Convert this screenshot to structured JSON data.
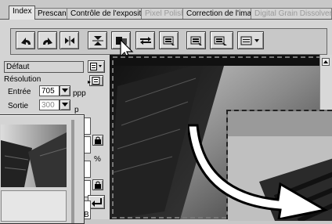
{
  "tabs": [
    {
      "label": "Index",
      "state": "active"
    },
    {
      "label": "Prescan",
      "state": "normal"
    },
    {
      "label": "Contrôle de l'exposition",
      "state": "normal"
    },
    {
      "label": "Pixel Polish",
      "state": "disabled"
    },
    {
      "label": "Correction de l'image",
      "state": "normal"
    },
    {
      "label": "Digital Grain Dissolver",
      "state": "disabled"
    }
  ],
  "toolbar": {
    "buttons": [
      {
        "name": "rotate-left-icon"
      },
      {
        "name": "rotate-right-icon"
      },
      {
        "name": "flip-horizontal-icon"
      },
      {
        "name": "flip-vertical-icon"
      },
      {
        "name": "compare-view-icon"
      },
      {
        "name": "swap-icon"
      },
      {
        "name": "scan-batch-icon"
      },
      {
        "name": "scan-batch-2-icon"
      },
      {
        "name": "options-menu-icon"
      }
    ]
  },
  "settings": {
    "preset_value": "Défaut",
    "resolution_label": "Résolution",
    "input_label": "Entrée",
    "input_value": "705",
    "input_unit": "ppp",
    "output_label": "Sortie",
    "output_value": "300",
    "output_unit": "p",
    "percent_symbol": "%",
    "b_label": "B"
  },
  "colors": {
    "background": "#c8c8c8",
    "panel": "#d4d4d4",
    "cursor_arrow": "#ffffff"
  }
}
